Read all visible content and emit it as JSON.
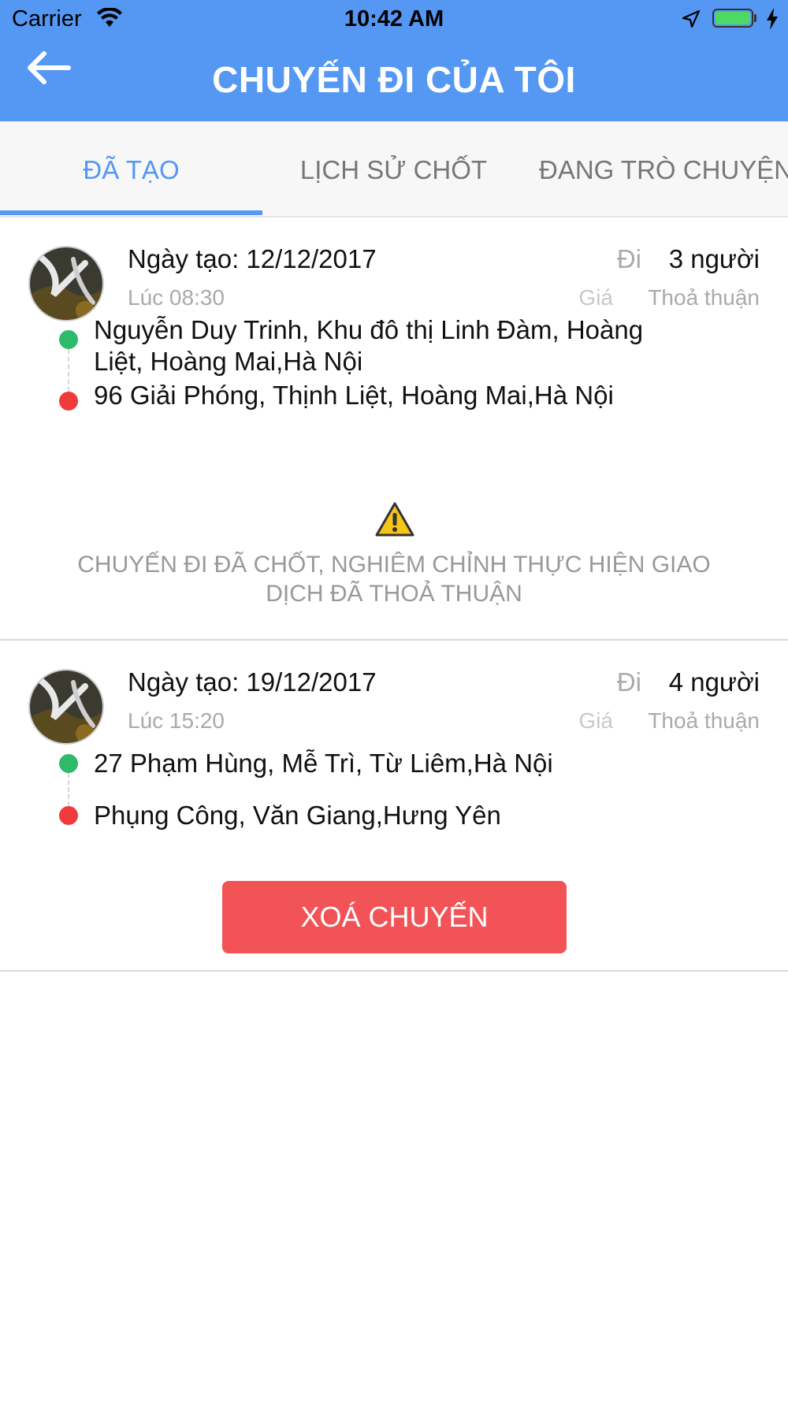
{
  "status_bar": {
    "carrier": "Carrier",
    "time": "10:42 AM",
    "battery_color": "#4cd964"
  },
  "nav": {
    "title": "CHUYẾN ĐI CỦA TÔI",
    "back_icon": "arrow-left-icon",
    "color": "#5598f4"
  },
  "tabs": [
    {
      "label": "ĐÃ TẠO",
      "active": true
    },
    {
      "label": "LỊCH SỬ CHỐT",
      "active": false
    },
    {
      "label": "ĐANG TRÒ CHUYỆN",
      "active": false
    }
  ],
  "trips": [
    {
      "created": "Ngày tạo: 12/12/2017",
      "time": "Lúc 08:30",
      "go_label": "Đi",
      "go_value": "3 người",
      "price_label": "Giá",
      "price_value": "Thoả thuận",
      "from": "Nguyễn Duy Trinh, Khu đô thị Linh Đàm, Hoàng Liệt, Hoàng Mai,Hà Nội",
      "to": "96 Giải Phóng, Thịnh Liệt, Hoàng Mai,Hà Nội",
      "notice": "CHUYẾN ĐI ĐÃ CHỐT, NGHIÊM CHỈNH THỰC HIỆN GIAO DỊCH ĐÃ THOẢ THUẬN",
      "notice_icon": "warning-icon"
    },
    {
      "created": "Ngày tạo: 19/12/2017",
      "time": "Lúc 15:20",
      "go_label": "Đi",
      "go_value": "4 người",
      "price_label": "Giá",
      "price_value": "Thoả thuận",
      "from": "27 Phạm Hùng, Mễ Trì, Từ Liêm,Hà Nội",
      "to": "Phụng Công, Văn Giang,Hưng Yên",
      "action_label": "XOÁ CHUYẾN",
      "action_color": "#f25357"
    }
  ],
  "colors": {
    "origin_dot": "#2dba6b",
    "destination_dot": "#ef3b3b",
    "warning": "#f5c518"
  }
}
